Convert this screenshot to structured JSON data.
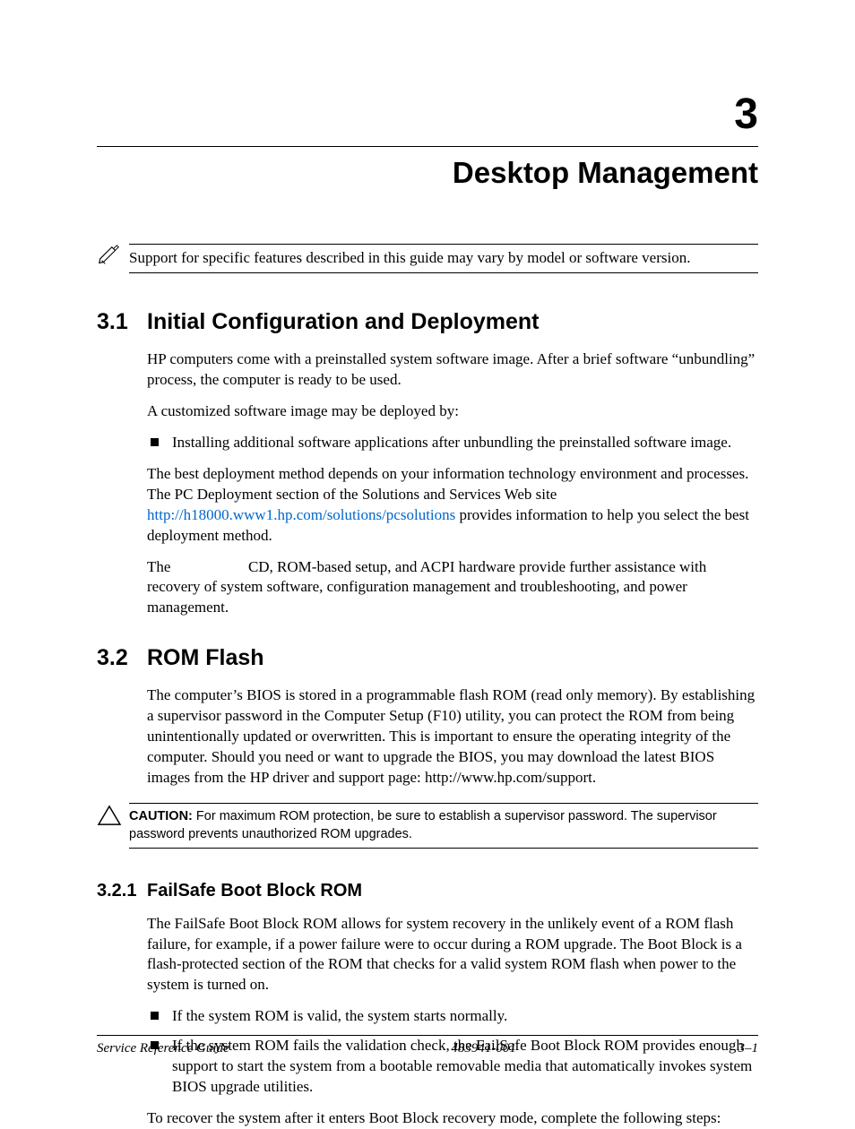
{
  "chapter": {
    "number": "3",
    "title": "Desktop Management"
  },
  "note": {
    "text": "Support for specific features described in this guide may vary by model or software version."
  },
  "s31": {
    "num": "3.1",
    "title": "Initial Configuration and Deployment",
    "p1": "HP computers come with a preinstalled system software image. After a brief software “unbundling” process, the computer is ready to be used.",
    "p2": "A customized software image may be deployed by:",
    "bullet1": "Installing additional software applications after unbundling the preinstalled software image.",
    "p3a": "The best deployment method depends on your information technology environment and processes. The PC Deployment section of the Solutions and Services Web site ",
    "link": "http://h18000.www1.hp.com/solutions/pcsolutions",
    "p3b": " provides information to help you select the best deployment method.",
    "p4a": "The ",
    "p4b": " CD, ROM-based setup, and ACPI hardware provide further assistance with recovery of system software, configuration management and troubleshooting, and power management."
  },
  "s32": {
    "num": "3.2",
    "title": "ROM Flash",
    "p1": "The computer’s BIOS is stored in a programmable flash ROM (read only memory). By establishing a supervisor password in the Computer Setup (F10) utility, you can protect the ROM from being unintentionally updated or overwritten. This is important to ensure the operating integrity of the computer. Should you need or want to upgrade the BIOS, you may download the latest BIOS images from the HP driver and support page: http://www.hp.com/support."
  },
  "caution": {
    "label": "CAUTION:",
    "text": " For maximum ROM protection, be sure to establish a supervisor password. The supervisor password prevents unauthorized ROM upgrades."
  },
  "s321": {
    "num": "3.2.1",
    "title": "FailSafe Boot Block ROM",
    "p1": "The FailSafe Boot Block ROM allows for system recovery in the unlikely event of a ROM flash failure, for example, if a power failure were to occur during a ROM upgrade. The Boot Block is a flash-protected section of the ROM that checks for a valid system ROM flash when power to the system is turned on.",
    "bullet1": "If the system ROM is valid, the system starts normally.",
    "bullet2": "If the system ROM fails the validation check, the FailSafe Boot Block ROM provides enough support to start the system from a bootable removable media that automatically invokes system BIOS upgrade utilities.",
    "p2": "To recover the system after it enters Boot Block recovery mode, complete the following steps:"
  },
  "footer": {
    "left": "Service Reference Guide",
    "center": "483941-001",
    "right": "3–1"
  }
}
